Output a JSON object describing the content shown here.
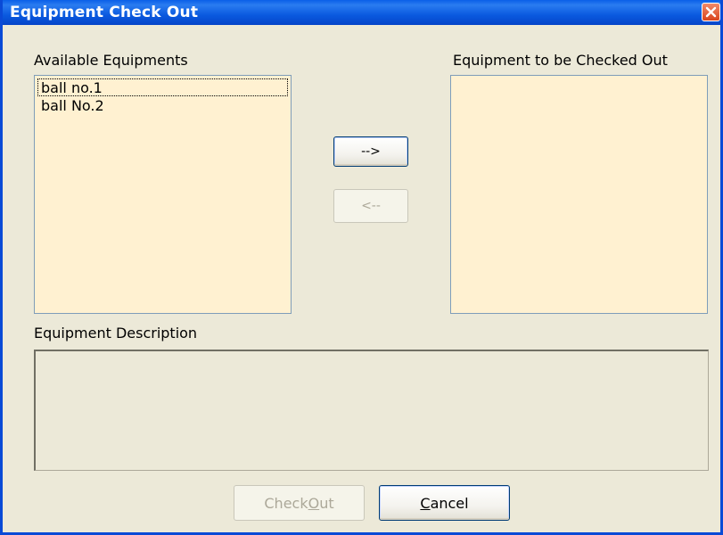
{
  "window": {
    "title": "Equipment Check Out"
  },
  "available": {
    "label": "Available Equipments",
    "items": [
      "ball no.1",
      "ball No.2"
    ]
  },
  "checkout_list": {
    "label": "Equipment to be Checked Out",
    "items": []
  },
  "transfer": {
    "add_label": "-->",
    "remove_label": "<--"
  },
  "description": {
    "label": "Equipment Description",
    "value": ""
  },
  "footer": {
    "checkout_prefix": "Check",
    "checkout_accel": "O",
    "checkout_suffix": "ut",
    "cancel_accel": "C",
    "cancel_suffix": "ancel"
  },
  "colors": {
    "titlebar": "#0a5ae0",
    "listbox_bg": "#fff1d1",
    "window_bg": "#ece9d8",
    "close_btn": "#d8441c"
  }
}
